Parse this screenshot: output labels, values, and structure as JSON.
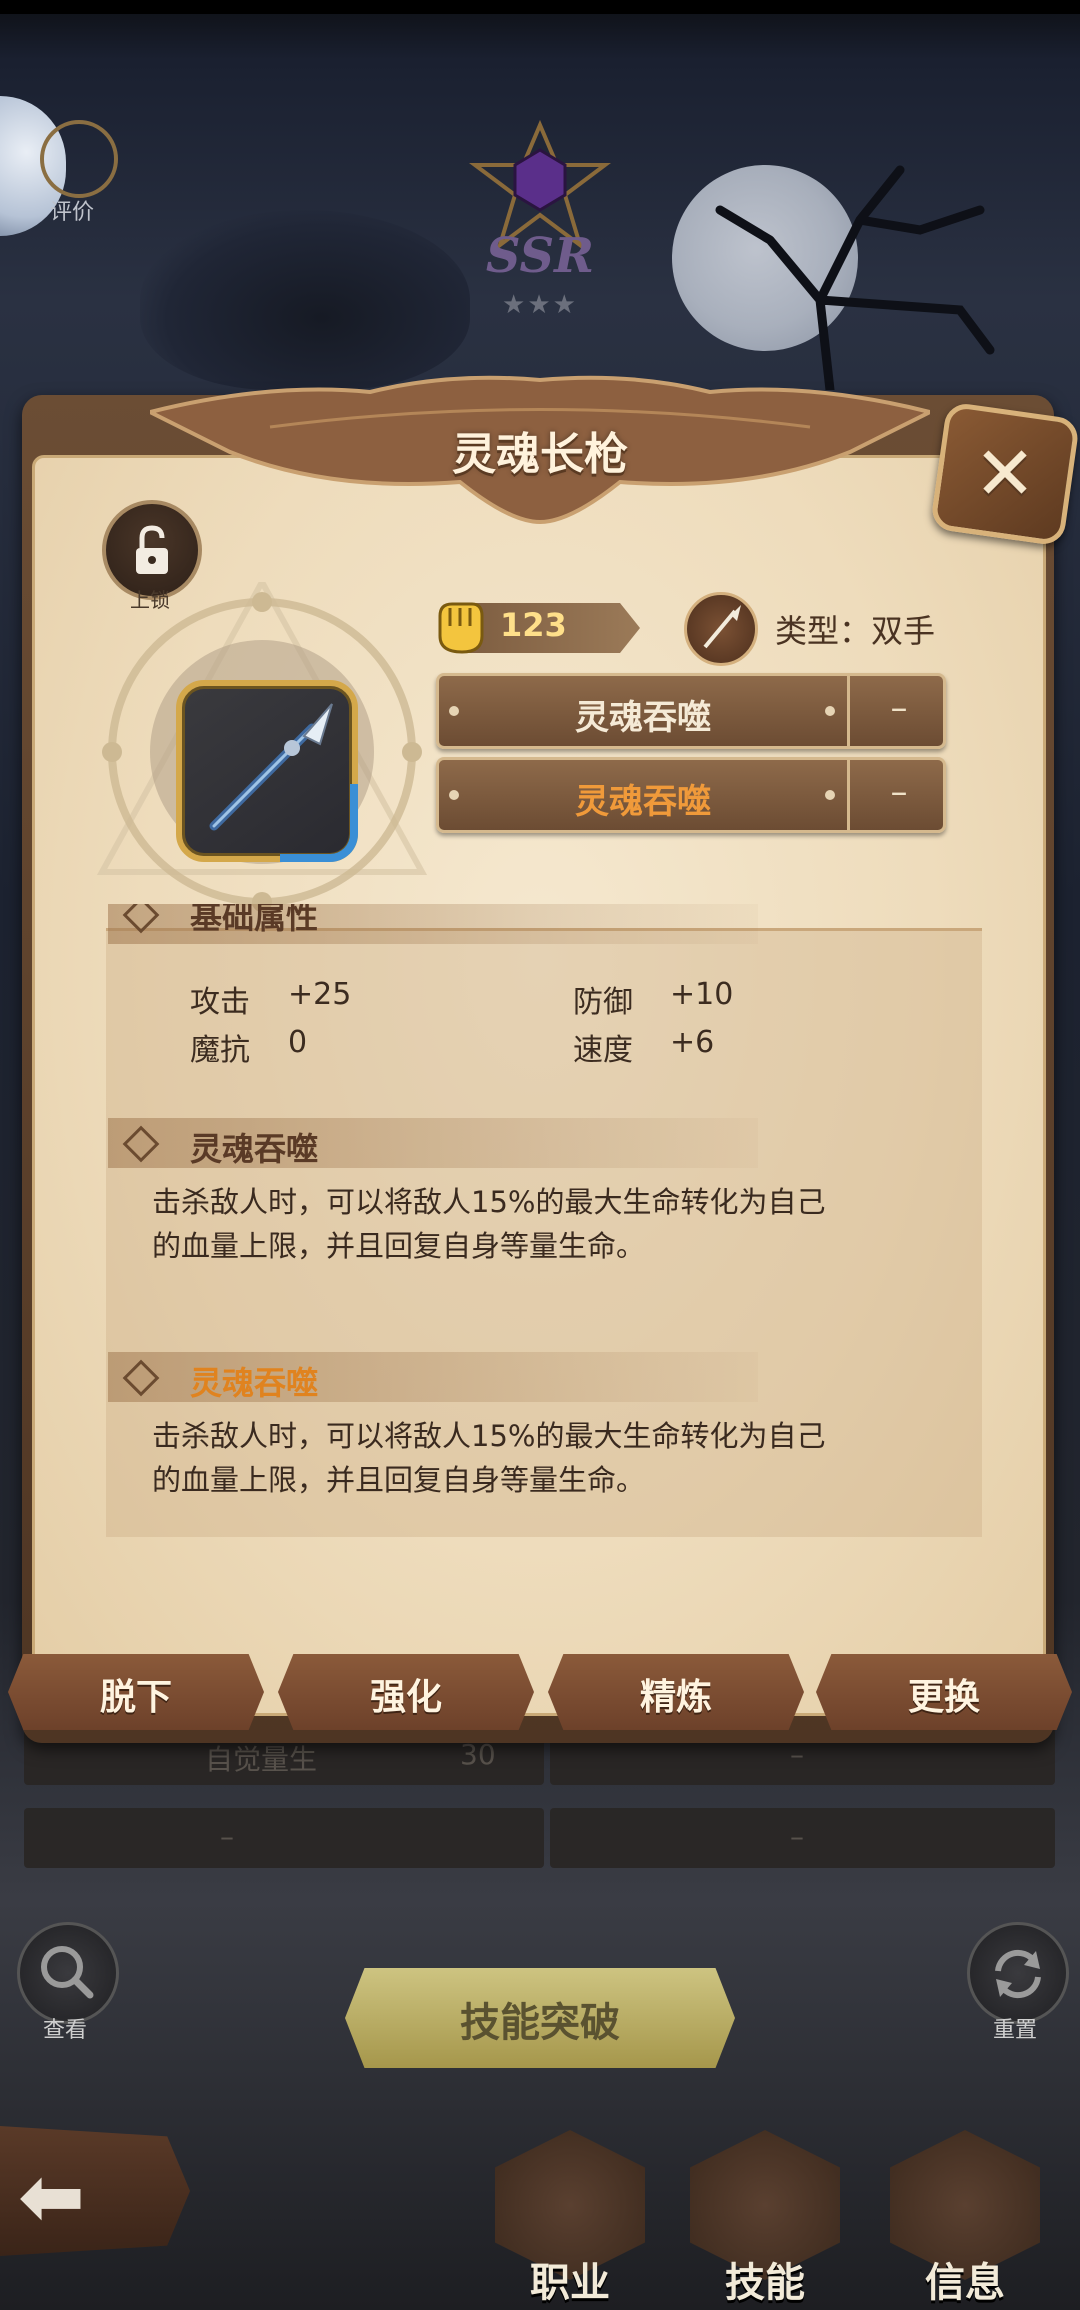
{
  "header": {
    "rarity": "SSR",
    "stars": "★★★",
    "review_label": "评价"
  },
  "dialog": {
    "title": "灵魂长枪",
    "lock_label": "上锁",
    "power": "123",
    "type_label": "类型：双手",
    "slots": [
      {
        "label": "灵魂吞噬",
        "value": "–",
        "color": "#f5ead6"
      },
      {
        "label": "灵魂吞噬",
        "value": "–",
        "color": "#f09a3a"
      }
    ],
    "base_attrs_title": "基础属性",
    "attributes": [
      {
        "name": "攻击",
        "value": "+25"
      },
      {
        "name": "防御",
        "value": "+10"
      },
      {
        "name": "魔抗",
        "value": "0"
      },
      {
        "name": "速度",
        "value": "+6"
      }
    ],
    "skills": [
      {
        "title": "灵魂吞噬",
        "color": "#5a3a26",
        "desc1": "击杀敌人时，可以将敌人15%的最大生命转化为自己",
        "desc2": "的血量上限，并且回复自身等量生命。"
      },
      {
        "title": "灵魂吞噬",
        "color": "#e0831f",
        "desc1": "击杀敌人时，可以将敌人15%的最大生命转化为自己",
        "desc2": "的血量上限，并且回复自身等量生命。"
      }
    ],
    "actions": [
      "脱下",
      "强化",
      "精炼",
      "更换"
    ]
  },
  "background_rows": {
    "row1_label": "自觉量生",
    "row1_value": "30",
    "dash": "–"
  },
  "bottom": {
    "search_label": "查看",
    "reset_label": "重置",
    "breakthrough_label": "技能突破",
    "tabs": [
      "职业",
      "技能",
      "信息"
    ]
  }
}
